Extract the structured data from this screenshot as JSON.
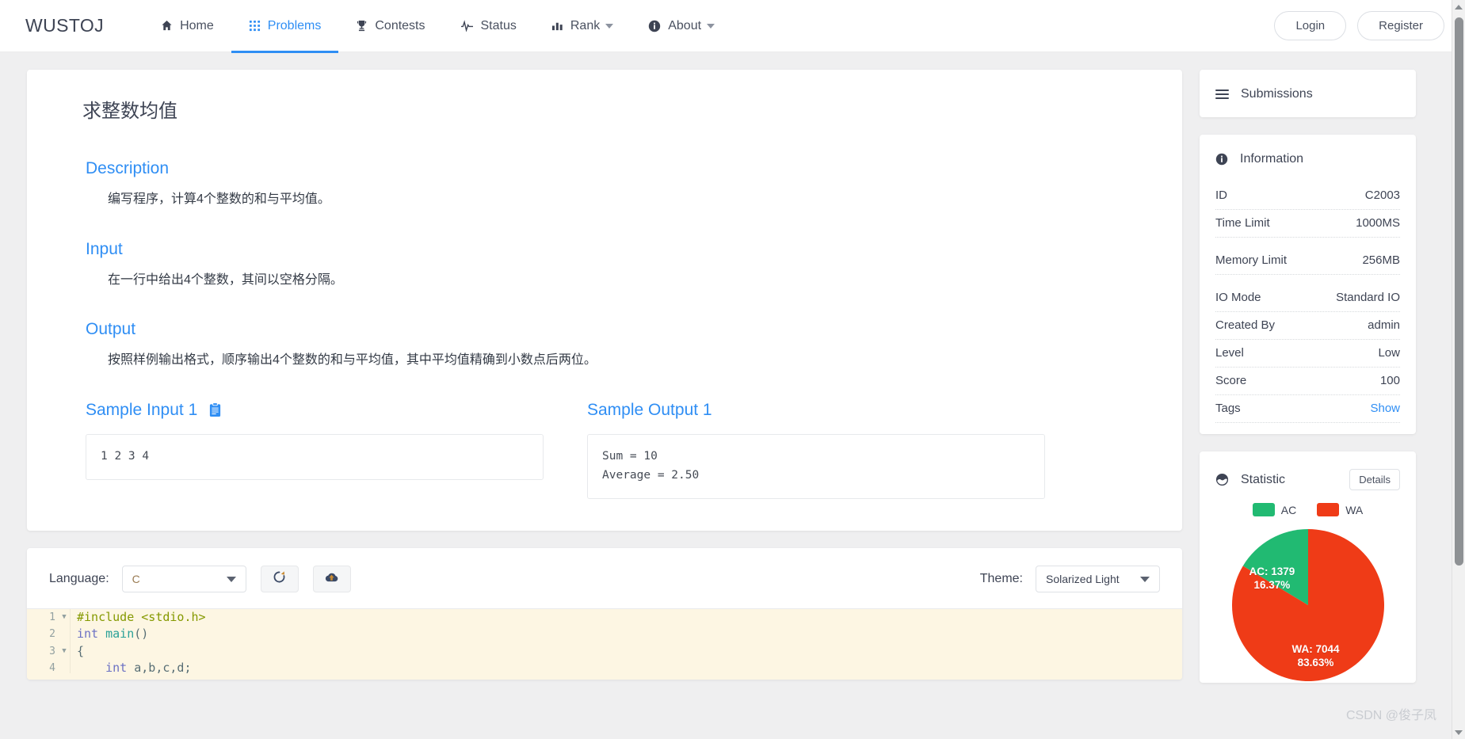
{
  "navbar": {
    "brand": "WUSTOJ",
    "items": [
      {
        "label": "Home",
        "icon": "home-icon",
        "active": false,
        "caret": false
      },
      {
        "label": "Problems",
        "icon": "grid-icon",
        "active": true,
        "caret": false
      },
      {
        "label": "Contests",
        "icon": "trophy-icon",
        "active": false,
        "caret": false
      },
      {
        "label": "Status",
        "icon": "pulse-icon",
        "active": false,
        "caret": false
      },
      {
        "label": "Rank",
        "icon": "bar-chart-icon",
        "active": false,
        "caret": true
      },
      {
        "label": "About",
        "icon": "info-circle-icon",
        "active": false,
        "caret": true
      }
    ],
    "login_label": "Login",
    "register_label": "Register"
  },
  "problem": {
    "title": "求整数均值",
    "sections": [
      {
        "heading": "Description",
        "body": "编写程序，计算4个整数的和与平均值。"
      },
      {
        "heading": "Input",
        "body": "在一行中给出4个整数，其间以空格分隔。"
      },
      {
        "heading": "Output",
        "body": "按照样例输出格式，顺序输出4个整数的和与平均值，其中平均值精确到小数点后两位。"
      }
    ],
    "sample_input": {
      "heading": "Sample Input 1",
      "copy_icon": "clipboard-copy-icon",
      "code": "1 2 3 4"
    },
    "sample_output": {
      "heading": "Sample Output 1",
      "code": "Sum = 10\nAverage = 2.50"
    }
  },
  "editor": {
    "language_label": "Language:",
    "language_value": "C",
    "reset_icon": "refresh-icon",
    "submit_icon": "cloud-upload-icon",
    "theme_label": "Theme:",
    "theme_value": "Solarized Light",
    "lines": [
      {
        "num": "1",
        "fold": true,
        "tokens": [
          {
            "t": "#include ",
            "c": "pre"
          },
          {
            "t": "<stdio.h>",
            "c": "str"
          }
        ]
      },
      {
        "num": "2",
        "fold": false,
        "tokens": [
          {
            "t": "int ",
            "c": "kw"
          },
          {
            "t": "main",
            "c": "fn"
          },
          {
            "t": "()",
            "c": "pun"
          }
        ]
      },
      {
        "num": "3",
        "fold": true,
        "tokens": [
          {
            "t": "{",
            "c": "pun"
          }
        ]
      },
      {
        "num": "4",
        "fold": false,
        "tokens": [
          {
            "t": "    ",
            "c": "plain"
          },
          {
            "t": "int ",
            "c": "kw"
          },
          {
            "t": "a,b,c,d;",
            "c": "plain"
          }
        ]
      }
    ]
  },
  "sidebar": {
    "submissions": {
      "label": "Submissions",
      "icon": "list-icon"
    },
    "information": {
      "label": "Information",
      "icon": "info-circle-icon",
      "rows": [
        {
          "key": "ID",
          "value": "C2003",
          "link": false
        },
        {
          "key": "Time Limit",
          "value": "1000MS",
          "link": false
        },
        {
          "key": "Memory Limit",
          "value": "256MB",
          "link": false
        },
        {
          "key": "IO Mode",
          "value": "Standard IO",
          "link": false
        },
        {
          "key": "Created By",
          "value": "admin",
          "link": false
        },
        {
          "key": "Level",
          "value": "Low",
          "link": false
        },
        {
          "key": "Score",
          "value": "100",
          "link": false
        },
        {
          "key": "Tags",
          "value": "Show",
          "link": true
        }
      ]
    },
    "statistic": {
      "label": "Statistic",
      "icon": "chart-pie-icon",
      "details_label": "Details"
    }
  },
  "chart_data": {
    "type": "pie",
    "title": "Statistic",
    "legend_position": "top",
    "labels": [
      "AC",
      "WA"
    ],
    "values": [
      1379,
      7044
    ],
    "percents": [
      16.37,
      83.63
    ],
    "colors": [
      "#21ba72",
      "#ef3b17"
    ],
    "annotations": [
      {
        "label": "AC: 1379",
        "sub": "16.37%"
      },
      {
        "label": "WA: 7044",
        "sub": "83.63%"
      }
    ]
  },
  "watermark": "CSDN @俊子凤",
  "colors": {
    "accent": "#2f8ef4",
    "text": "#3e4454",
    "ac_green": "#21ba72",
    "wa_red": "#ef3b17",
    "editor_bg": "#fdf6e3"
  }
}
